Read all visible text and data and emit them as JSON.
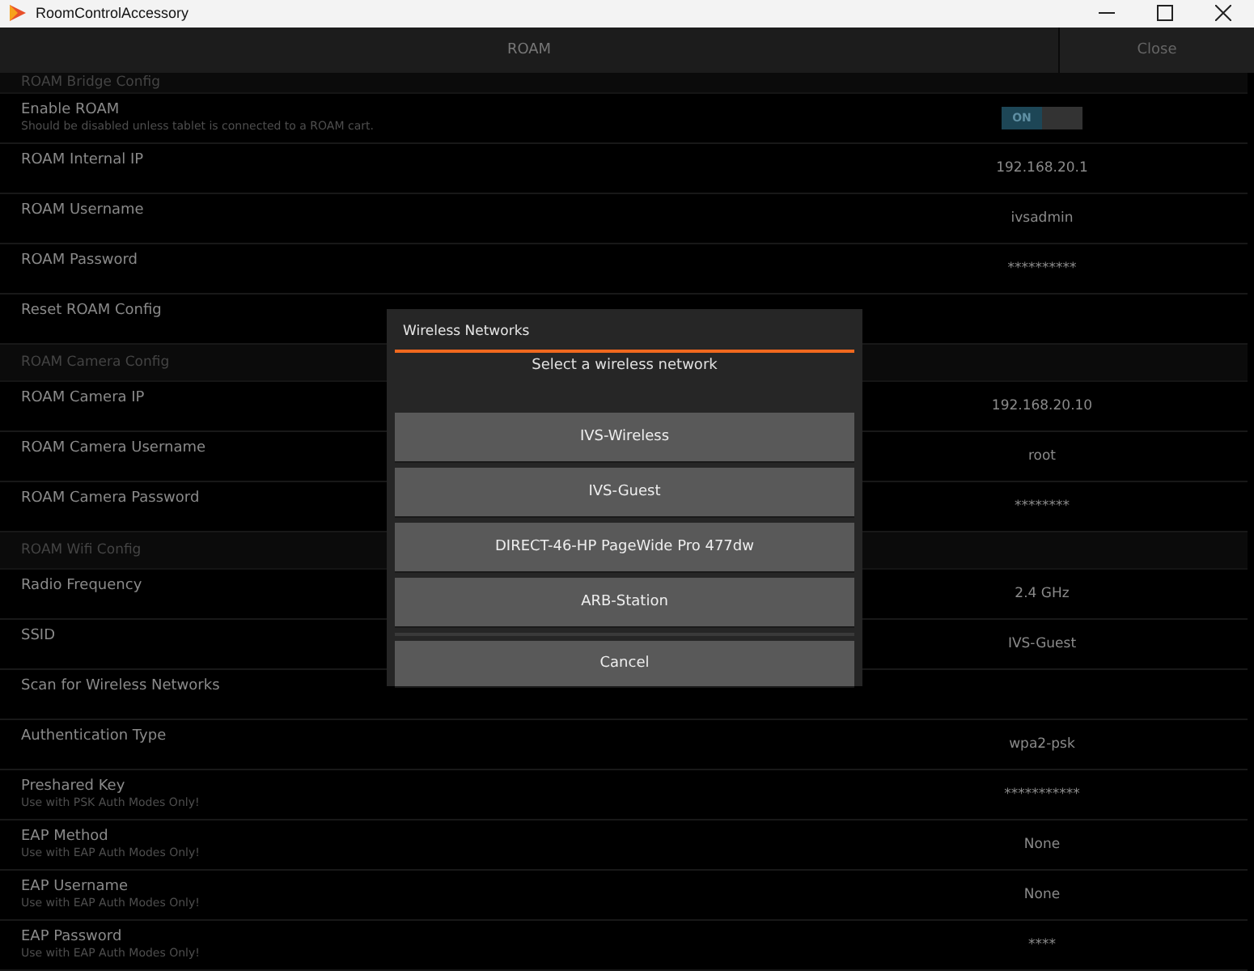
{
  "window": {
    "title": "RoomControlAccessory"
  },
  "header": {
    "title": "ROAM",
    "close_button": "Close"
  },
  "settings": [
    {
      "kind": "section",
      "label": "ROAM Bridge Config"
    },
    {
      "kind": "toggle",
      "label": "Enable ROAM",
      "hint": "Should be disabled unless tablet is connected to a ROAM cart.",
      "on": true,
      "toggle_label": "ON"
    },
    {
      "kind": "value",
      "label": "ROAM Internal IP",
      "value": "192.168.20.1"
    },
    {
      "kind": "value",
      "label": "ROAM Username",
      "value": "ivsadmin"
    },
    {
      "kind": "value",
      "label": "ROAM Password",
      "value": "**********"
    },
    {
      "kind": "value",
      "label": "Reset ROAM Config"
    },
    {
      "kind": "section",
      "label": "ROAM Camera Config"
    },
    {
      "kind": "value",
      "label": "ROAM Camera IP",
      "value": "192.168.20.10"
    },
    {
      "kind": "value",
      "label": "ROAM Camera Username",
      "value": "root"
    },
    {
      "kind": "value",
      "label": "ROAM Camera Password",
      "value": "********"
    },
    {
      "kind": "section",
      "label": "ROAM Wifi Config"
    },
    {
      "kind": "value",
      "label": "Radio Frequency",
      "value": "2.4 GHz"
    },
    {
      "kind": "value",
      "label": "SSID",
      "value": "IVS-Guest"
    },
    {
      "kind": "value",
      "label": "Scan for Wireless Networks"
    },
    {
      "kind": "value",
      "label": "Authentication Type",
      "value": "wpa2-psk"
    },
    {
      "kind": "value",
      "label": "Preshared Key",
      "hint": "Use with PSK Auth Modes Only!",
      "value": "***********"
    },
    {
      "kind": "value",
      "label": "EAP Method",
      "hint": "Use with EAP Auth Modes Only!",
      "value": "None"
    },
    {
      "kind": "value",
      "label": "EAP Username",
      "hint": "Use with EAP Auth Modes Only!",
      "value": "None"
    },
    {
      "kind": "value",
      "label": "EAP Password",
      "hint": "Use with EAP Auth Modes Only!",
      "value": "****"
    }
  ],
  "dialog": {
    "title": "Wireless Networks",
    "message": "Select a wireless network",
    "networks": [
      "IVS-Wireless",
      "IVS-Guest",
      "DIRECT-46-HP PageWide Pro 477dw",
      "ARB-Station"
    ],
    "cancel": "Cancel"
  }
}
